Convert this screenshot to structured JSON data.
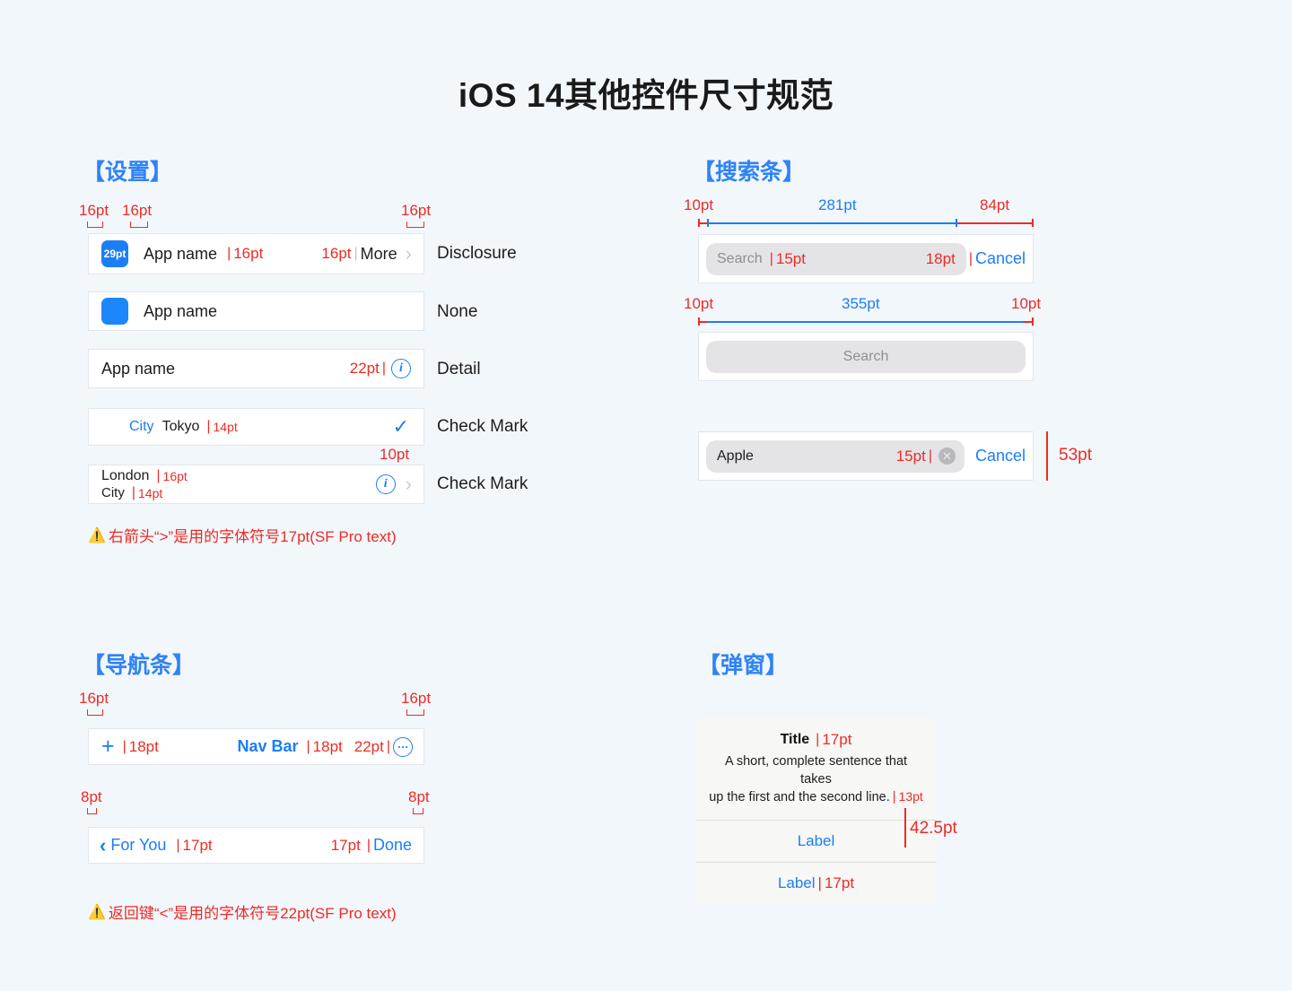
{
  "page": {
    "title": "iOS 14其他控件尺寸规范",
    "background_color": "#f2f7fc",
    "accent_blue": "#1b7ef6",
    "accent_red": "#ee2b24"
  },
  "sections": {
    "settings": {
      "heading": "【设置】",
      "measurements": {
        "left1": "16pt",
        "left2": "16pt",
        "right": "16pt",
        "detail_gap": "10pt"
      },
      "rows": [
        {
          "icon_label": "29pt",
          "title": "App name",
          "title_size": "16pt",
          "value_size": "16pt",
          "value": "More",
          "accessory": "chevron-right",
          "type_label": "Disclosure"
        },
        {
          "icon_label": "",
          "title": "App name",
          "type_label": "None"
        },
        {
          "title": "App name",
          "value_size": "22pt",
          "accessory": "info-circle",
          "type_label": "Detail"
        },
        {
          "key": "City",
          "value": "Tokyo",
          "value_size": "14pt",
          "accessory": "checkmark",
          "type_label": "Check Mark"
        },
        {
          "line1": "London",
          "line1_size": "16pt",
          "line2": "City",
          "line2_size": "14pt",
          "accessory": "info-circle-and-chevron",
          "type_label": "Check Mark"
        }
      ],
      "note": "右箭头“>”是用的字体符号17pt(SF Pro text)"
    },
    "search": {
      "heading": "【搜索条】",
      "bar1": {
        "measurements": {
          "left": "10pt",
          "middle": "281pt",
          "right": "84pt"
        },
        "placeholder": "Search",
        "placeholder_size": "15pt",
        "gap_size": "18pt",
        "cancel_label": "Cancel"
      },
      "bar2": {
        "measurements": {
          "left": "10pt",
          "middle": "355pt",
          "right": "10pt"
        },
        "placeholder": "Search"
      },
      "bar3": {
        "value": "Apple",
        "value_size": "15pt",
        "clear_icon": "clear-circle-icon",
        "cancel_label": "Cancel",
        "height_label": "53pt"
      }
    },
    "navbar": {
      "heading": "【导航条】",
      "bar1": {
        "measurements": {
          "left": "16pt",
          "right": "16pt"
        },
        "left_icon": "plus-icon",
        "left_gap": "18pt",
        "title": "Nav Bar",
        "right_gap1": "18pt",
        "right_gap2": "22pt",
        "right_icon": "more-circle-icon"
      },
      "bar2": {
        "measurements": {
          "left": "8pt",
          "right": "8pt"
        },
        "back_label": "For You",
        "back_size": "17pt",
        "right_size": "17pt",
        "right_label": "Done"
      },
      "note": "返回键“<”是用的字体符号22pt(SF Pro text)"
    },
    "alert": {
      "heading": "【弹窗】",
      "title": "Title",
      "title_size": "17pt",
      "message_line1": "A short, complete sentence that takes",
      "message_line2": "up the first and the second line.",
      "message_size": "13pt",
      "button1": "Label",
      "button1_height": "42.5pt",
      "button2": "Label",
      "button2_size": "17pt"
    }
  }
}
